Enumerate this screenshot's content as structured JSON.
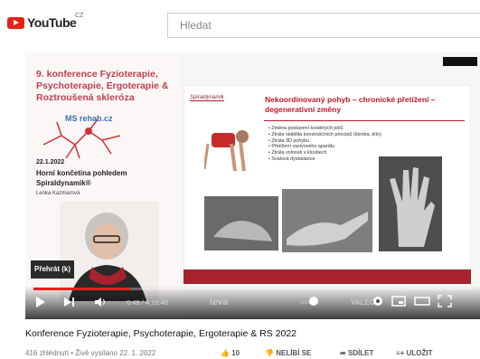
{
  "header": {
    "logo": "YouTube",
    "country": "CZ",
    "search_placeholder": "Hledat"
  },
  "slide_left": {
    "title": "9. konference Fyzioterapie, Psychoterapie, Ergoterapie & Roztroušená skleróza",
    "date": "22.1.2022",
    "lecture_title": "Horní končetina pohledem Spiraldynamik®",
    "author": "Lenka Kazmarová",
    "logo_text": "MS rehab.cz"
  },
  "slide_main": {
    "brand": "Spiraldynamik",
    "title": "Nekoordinovaný pohyb – chronické přetížení – degenerativní změny",
    "bullets": [
      "Změna postavení kostěných pólů",
      "Ztráta stabilita konstrukčních principů (klenba, klín)",
      "Ztráta 3D pohybu",
      "Přetížení vazivového aparátu",
      "Ztráta volnosti v kloubech",
      "Svalová dysbalance"
    ]
  },
  "player": {
    "tooltip": "Přehrát (k)",
    "time": "0:49 / 4:19:46",
    "sponsor1": "teva",
    "sponsor2": "VALEO",
    "progress": 0.22
  },
  "video": {
    "title": "Konference Fyzioterapie, Psychoterapie, Ergoterapie & RS 2022",
    "meta": "416 zhlédnutí • Živě vysíláno 22. 1. 2022",
    "likes": "10",
    "dislike": "NELÍBÍ SE",
    "share": "SDÍLET",
    "save": "ULOŽIT"
  }
}
